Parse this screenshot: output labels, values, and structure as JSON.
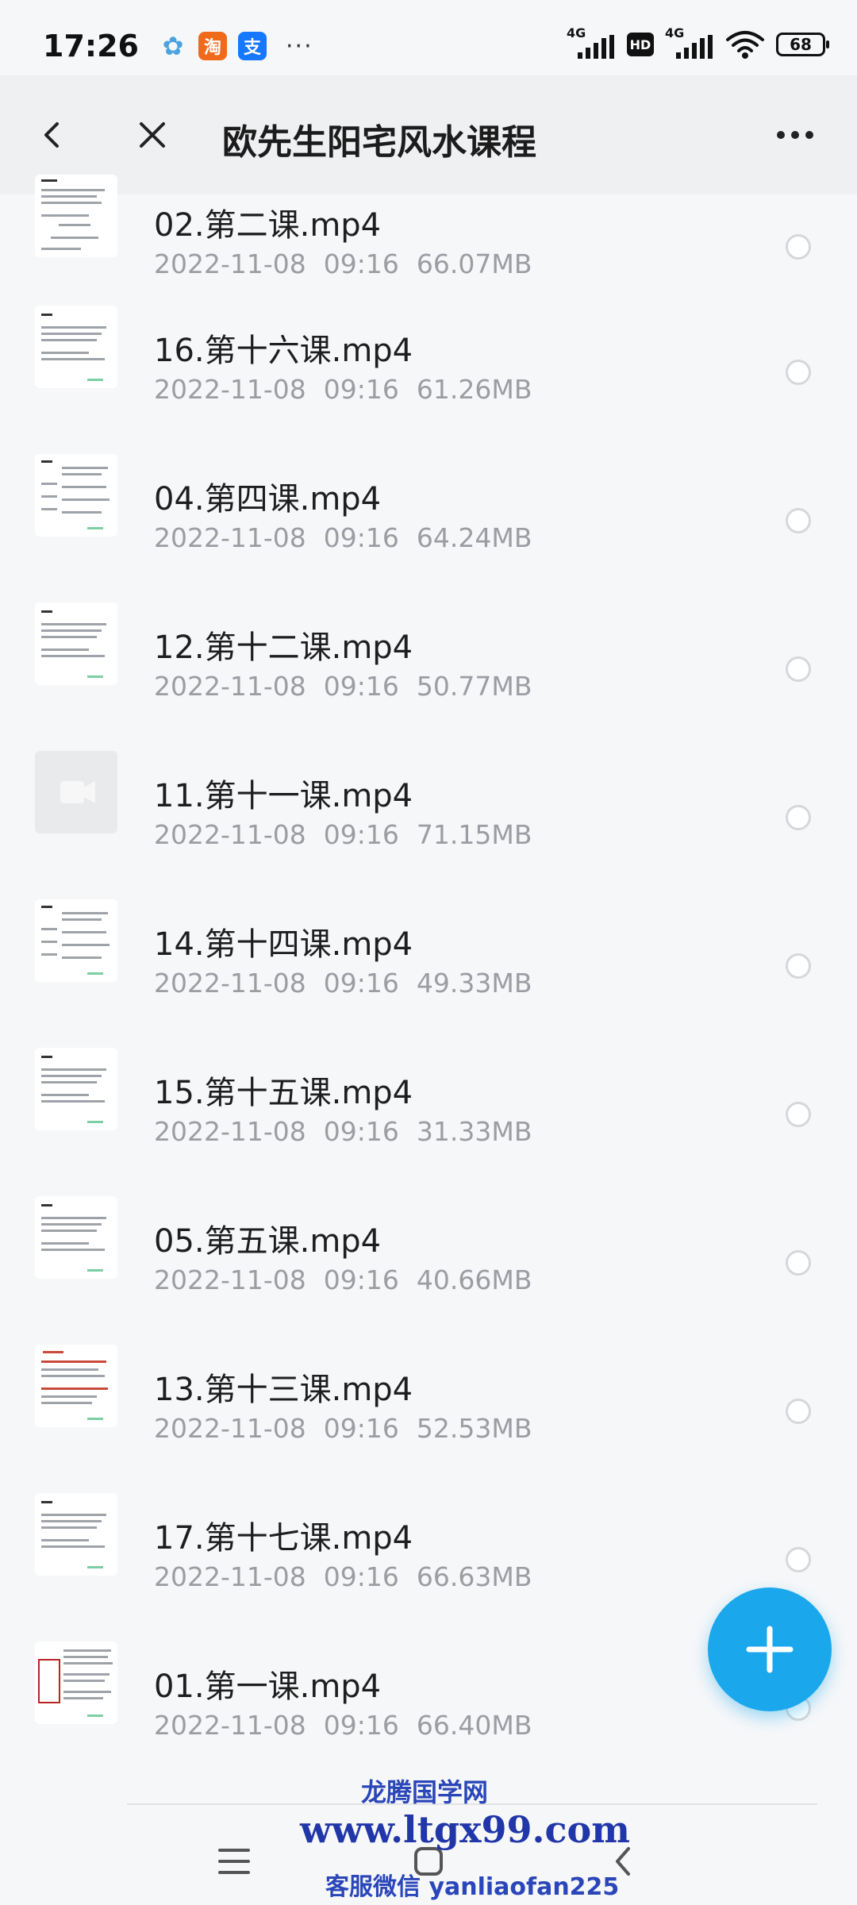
{
  "status_bar": {
    "time": "17:26",
    "apps": [
      {
        "icon": "flower-icon",
        "label": "✿",
        "color": "#4aa3df"
      },
      {
        "icon": "taobao-icon",
        "label": "淘",
        "color": "#f06a1b"
      },
      {
        "icon": "alipay-icon",
        "label": "支",
        "color": "#1677ff"
      }
    ],
    "more": "···",
    "net1": "4G",
    "hd": "HD",
    "net2": "4G",
    "battery": "68"
  },
  "header": {
    "title": "欧先生阳宅风水课程"
  },
  "files": [
    {
      "name": "02.第二课.mp4",
      "date": "2022-11-08",
      "time": "09:16",
      "size": "66.07MB",
      "thumb": "doc-diagram"
    },
    {
      "name": "16.第十六课.mp4",
      "date": "2022-11-08",
      "time": "09:16",
      "size": "61.26MB",
      "thumb": "doc-text"
    },
    {
      "name": "04.第四课.mp4",
      "date": "2022-11-08",
      "time": "09:16",
      "size": "64.24MB",
      "thumb": "doc-grid"
    },
    {
      "name": "12.第十二课.mp4",
      "date": "2022-11-08",
      "time": "09:16",
      "size": "50.77MB",
      "thumb": "doc-text"
    },
    {
      "name": "11.第十一课.mp4",
      "date": "2022-11-08",
      "time": "09:16",
      "size": "71.15MB",
      "thumb": "video"
    },
    {
      "name": "14.第十四课.mp4",
      "date": "2022-11-08",
      "time": "09:16",
      "size": "49.33MB",
      "thumb": "doc-grid"
    },
    {
      "name": "15.第十五课.mp4",
      "date": "2022-11-08",
      "time": "09:16",
      "size": "31.33MB",
      "thumb": "doc-text"
    },
    {
      "name": "05.第五课.mp4",
      "date": "2022-11-08",
      "time": "09:16",
      "size": "40.66MB",
      "thumb": "doc-text"
    },
    {
      "name": "13.第十三课.mp4",
      "date": "2022-11-08",
      "time": "09:16",
      "size": "52.53MB",
      "thumb": "doc-red"
    },
    {
      "name": "17.第十七课.mp4",
      "date": "2022-11-08",
      "time": "09:16",
      "size": "66.63MB",
      "thumb": "doc-text"
    },
    {
      "name": "01.第一课.mp4",
      "date": "2022-11-08",
      "time": "09:16",
      "size": "66.40MB",
      "thumb": "doc-seal"
    }
  ],
  "watermark": {
    "line1": "龙腾国学网",
    "line2": "www.ltgx99.com",
    "line3": "客服微信 yanliaofan225"
  },
  "colors": {
    "accent": "#1aa7ec",
    "meta": "#9b9da2"
  }
}
